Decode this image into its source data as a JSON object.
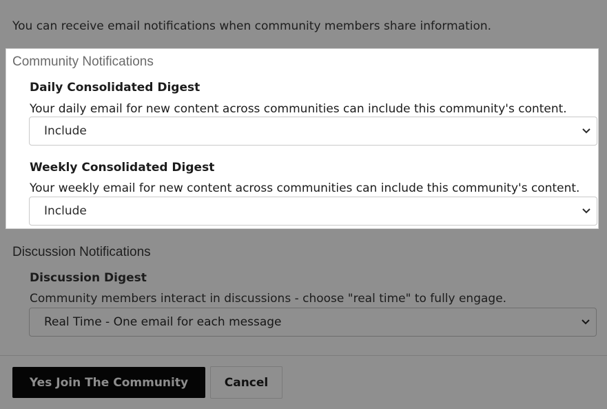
{
  "intro_text": "You can receive email notifications when community members share information.",
  "community": {
    "title": "Community Notifications",
    "daily": {
      "title": "Daily Consolidated Digest",
      "description": "Your daily email for new content across communities can include this community's content.",
      "value": "Include"
    },
    "weekly": {
      "title": "Weekly Consolidated Digest",
      "description": "Your weekly email for new content across communities can include this community's content.",
      "value": "Include"
    }
  },
  "discussion": {
    "title": "Discussion Notifications",
    "digest": {
      "title": "Discussion Digest",
      "description": "Community members interact in discussions - choose \"real time\" to fully engage.",
      "value": "Real Time - One email for each message"
    }
  },
  "actions": {
    "join_label": "Yes Join The Community",
    "cancel_label": "Cancel"
  },
  "icons": {
    "select_chevron": "chevron-down-icon"
  }
}
